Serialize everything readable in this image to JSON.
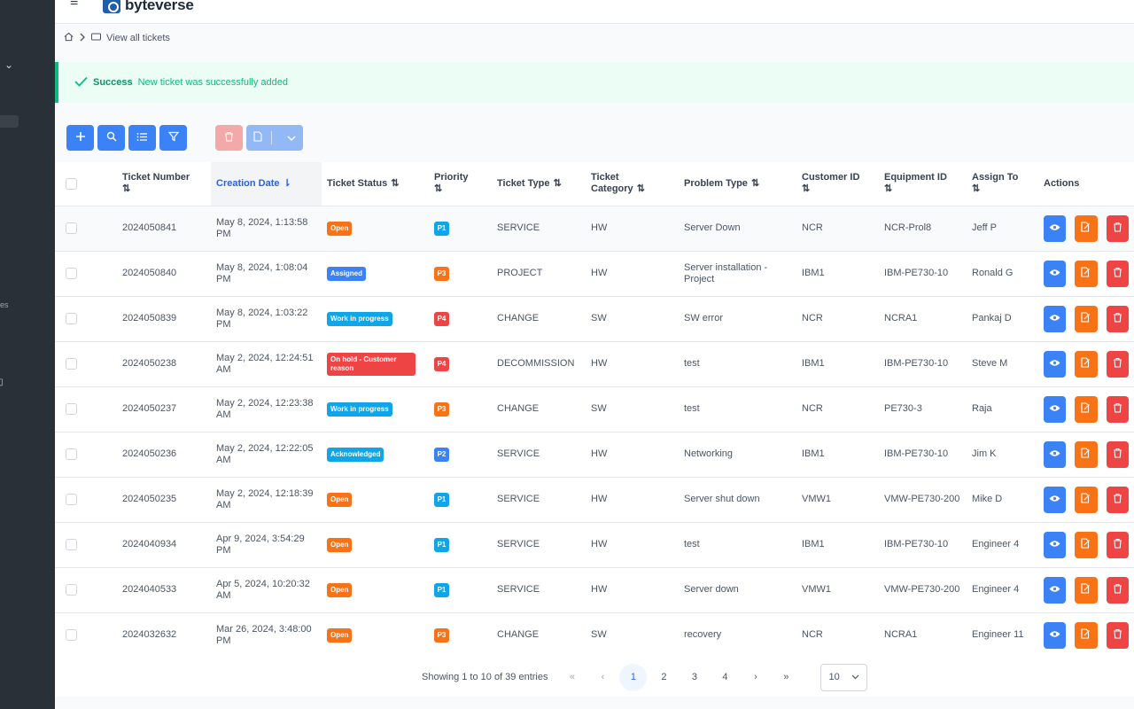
{
  "app": {
    "brand": "byteverse"
  },
  "sidebar": {
    "partial_text": "es"
  },
  "breadcrumb": {
    "current": "View all tickets"
  },
  "alert": {
    "title": "Success",
    "message": "New ticket was successfully added"
  },
  "table": {
    "headers": {
      "ticket_number": "Ticket Number",
      "creation_date": "Creation Date",
      "ticket_status": "Ticket Status",
      "priority": "Priority",
      "ticket_type": "Ticket Type",
      "ticket_category": "Ticket Category",
      "problem_type": "Problem Type",
      "customer_id": "Customer ID",
      "equipment_id": "Equipment ID",
      "assign_to": "Assign To",
      "actions": "Actions"
    },
    "rows": [
      {
        "number": "2024050841",
        "date": "May 8, 2024, 1:13:58 PM",
        "status": "Open",
        "status_color": "#f97316",
        "priority": "P1",
        "priority_color": "#0ea5e9",
        "type": "SERVICE",
        "category": "HW",
        "problem": "Server Down",
        "customer": "NCR",
        "equipment": "NCR-Prol8",
        "assignee": "Jeff P"
      },
      {
        "number": "2024050840",
        "date": "May 8, 2024, 1:08:04 PM",
        "status": "Assigned",
        "status_color": "#3b82f6",
        "priority": "P3",
        "priority_color": "#f97316",
        "type": "PROJECT",
        "category": "HW",
        "problem": "Server installation - Project",
        "customer": "IBM1",
        "equipment": "IBM-PE730-10",
        "assignee": "Ronald G"
      },
      {
        "number": "2024050839",
        "date": "May 8, 2024, 1:03:22 PM",
        "status": "Work in progress",
        "status_color": "#0ea5e9",
        "priority": "P4",
        "priority_color": "#ef4444",
        "type": "CHANGE",
        "category": "SW",
        "problem": "SW error",
        "customer": "NCR",
        "equipment": "NCRA1",
        "assignee": "Pankaj D"
      },
      {
        "number": "2024050238",
        "date": "May 2, 2024, 12:24:51 AM",
        "status": "On hold - Customer reason",
        "status_color": "#ef4444",
        "priority": "P4",
        "priority_color": "#ef4444",
        "type": "DECOMMISSION",
        "category": "HW",
        "problem": "test",
        "customer": "IBM1",
        "equipment": "IBM-PE730-10",
        "assignee": "Steve M"
      },
      {
        "number": "2024050237",
        "date": "May 2, 2024, 12:23:38 AM",
        "status": "Work in progress",
        "status_color": "#0ea5e9",
        "priority": "P3",
        "priority_color": "#f97316",
        "type": "CHANGE",
        "category": "SW",
        "problem": "test",
        "customer": "NCR",
        "equipment": "PE730-3",
        "assignee": "Raja"
      },
      {
        "number": "2024050236",
        "date": "May 2, 2024, 12:22:05 AM",
        "status": "Acknowledged",
        "status_color": "#0ea5e9",
        "priority": "P2",
        "priority_color": "#3b82f6",
        "type": "SERVICE",
        "category": "HW",
        "problem": "Networking",
        "customer": "IBM1",
        "equipment": "IBM-PE730-10",
        "assignee": "Jim K"
      },
      {
        "number": "2024050235",
        "date": "May 2, 2024, 12:18:39 AM",
        "status": "Open",
        "status_color": "#f97316",
        "priority": "P1",
        "priority_color": "#0ea5e9",
        "type": "SERVICE",
        "category": "HW",
        "problem": "Server shut down",
        "customer": "VMW1",
        "equipment": "VMW-PE730-200",
        "assignee": "Mike D"
      },
      {
        "number": "2024040934",
        "date": "Apr 9, 2024, 3:54:29 PM",
        "status": "Open",
        "status_color": "#f97316",
        "priority": "P1",
        "priority_color": "#0ea5e9",
        "type": "SERVICE",
        "category": "HW",
        "problem": "test",
        "customer": "IBM1",
        "equipment": "IBM-PE730-10",
        "assignee": "Engineer 4"
      },
      {
        "number": "2024040533",
        "date": "Apr 5, 2024, 10:20:32 AM",
        "status": "Open",
        "status_color": "#f97316",
        "priority": "P1",
        "priority_color": "#0ea5e9",
        "type": "SERVICE",
        "category": "HW",
        "problem": "Server down",
        "customer": "VMW1",
        "equipment": "VMW-PE730-200",
        "assignee": "Engineer 4"
      },
      {
        "number": "2024032632",
        "date": "Mar 26, 2024, 3:48:00 PM",
        "status": "Open",
        "status_color": "#f97316",
        "priority": "P3",
        "priority_color": "#f97316",
        "type": "CHANGE",
        "category": "SW",
        "problem": "recovery",
        "customer": "NCR",
        "equipment": "NCRA1",
        "assignee": "Engineer 11"
      }
    ]
  },
  "pagination": {
    "info": "Showing 1 to 10 of 39 entries",
    "first": "«",
    "prev": "‹",
    "pages": [
      "1",
      "2",
      "3",
      "4"
    ],
    "next": "›",
    "last": "»",
    "page_size": "10"
  },
  "icons": {
    "add": "plus-icon",
    "search": "search-icon",
    "list": "list-icon",
    "filter": "filter-icon",
    "delete": "trash-icon",
    "export": "file-icon",
    "view": "eye-icon",
    "edit": "edit-icon"
  },
  "colors": {
    "primary": "#3b82f6",
    "warning": "#f97316",
    "danger": "#ef4444",
    "success": "#10b981",
    "sidebar": "#2a3037"
  }
}
